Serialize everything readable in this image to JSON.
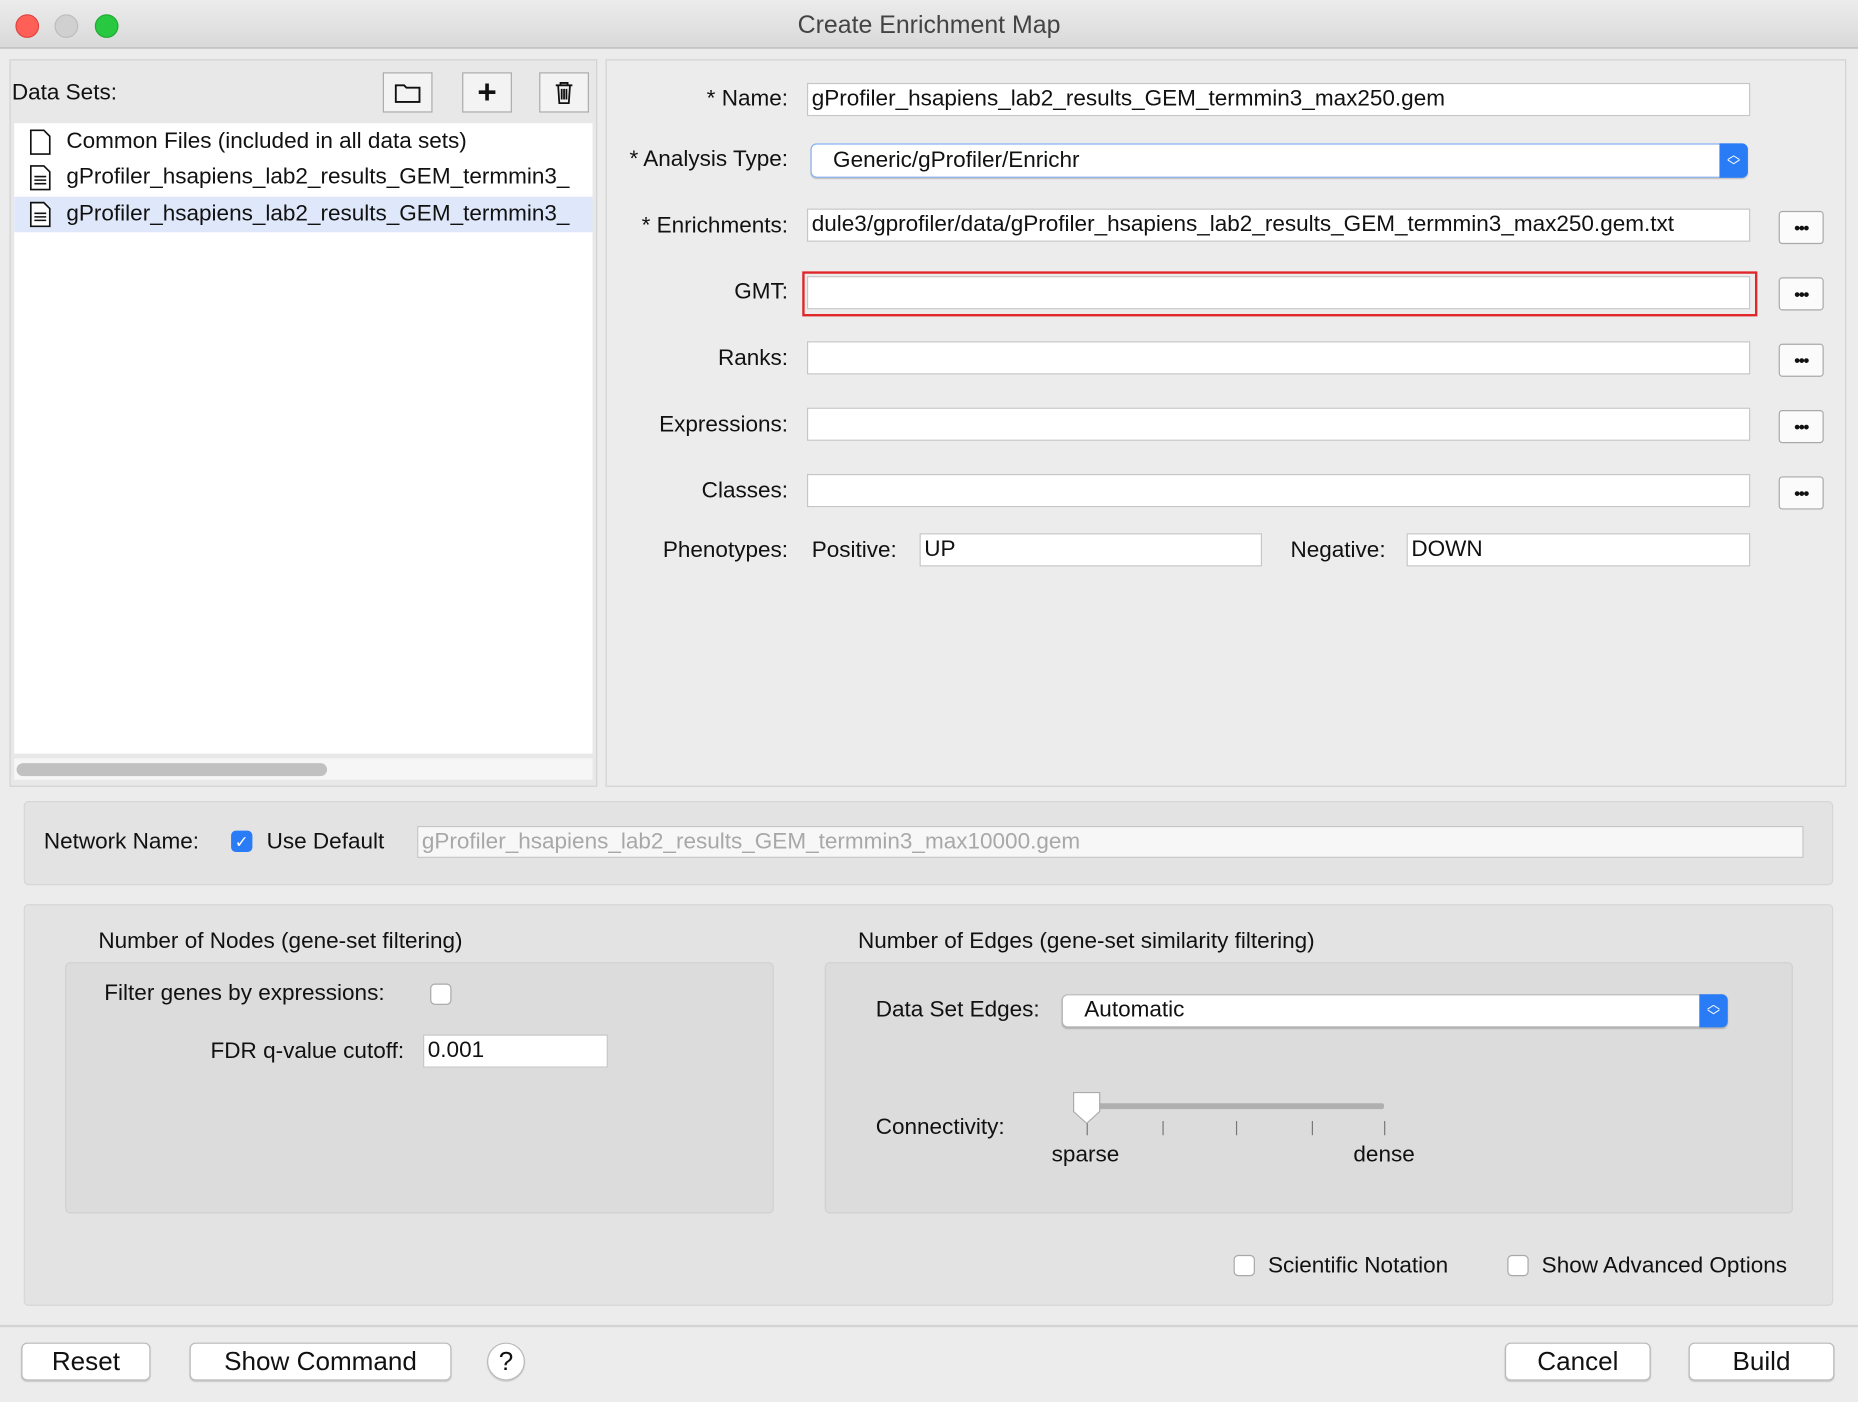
{
  "window": {
    "title": "Create Enrichment Map"
  },
  "datasets": {
    "label": "Data Sets:",
    "items": [
      {
        "label": "Common Files (included in all data sets)",
        "icon": "blank-file-icon",
        "selected": false
      },
      {
        "label": "gProfiler_hsapiens_lab2_results_GEM_termmin3_",
        "icon": "text-file-icon",
        "selected": false
      },
      {
        "label": "gProfiler_hsapiens_lab2_results_GEM_termmin3_",
        "icon": "text-file-icon",
        "selected": true
      }
    ]
  },
  "form": {
    "name_label": "* Name:",
    "name_value": "gProfiler_hsapiens_lab2_results_GEM_termmin3_max250.gem",
    "analysis_label": "* Analysis Type:",
    "analysis_value": "Generic/gProfiler/Enrichr",
    "enrichments_label": "* Enrichments:",
    "enrichments_value": "dule3/gprofiler/data/gProfiler_hsapiens_lab2_results_GEM_termmin3_max250.gem.txt",
    "gmt_label": "GMT:",
    "gmt_value": "",
    "ranks_label": "Ranks:",
    "ranks_value": "",
    "expressions_label": "Expressions:",
    "expressions_value": "",
    "classes_label": "Classes:",
    "classes_value": "",
    "phenotypes_label": "Phenotypes:",
    "positive_label": "Positive:",
    "positive_value": "UP",
    "negative_label": "Negative:",
    "negative_value": "DOWN",
    "browse_label": "•••"
  },
  "network": {
    "label": "Network Name:",
    "use_default_label": "Use Default",
    "use_default_checked": true,
    "value": "gProfiler_hsapiens_lab2_results_GEM_termmin3_max10000.gem"
  },
  "nodes": {
    "title": "Number of Nodes (gene-set filtering)",
    "filter_label": "Filter genes by expressions:",
    "filter_checked": false,
    "fdr_label": "FDR q-value cutoff:",
    "fdr_value": "0.001"
  },
  "edges": {
    "title": "Number of Edges (gene-set similarity filtering)",
    "dataset_edges_label": "Data Set Edges:",
    "dataset_edges_value": "Automatic",
    "connectivity_label": "Connectivity:",
    "connectivity_level": 0,
    "sparse_label": "sparse",
    "dense_label": "dense"
  },
  "options": {
    "scientific_label": "Scientific Notation",
    "scientific_checked": false,
    "advanced_label": "Show Advanced Options",
    "advanced_checked": false
  },
  "footer": {
    "reset": "Reset",
    "show_command": "Show Command",
    "help": "?",
    "cancel": "Cancel",
    "build": "Build"
  },
  "colors": {
    "accent": "#2a7cf6",
    "error_border": "#e0262a",
    "selection": "#dfe8fb"
  }
}
